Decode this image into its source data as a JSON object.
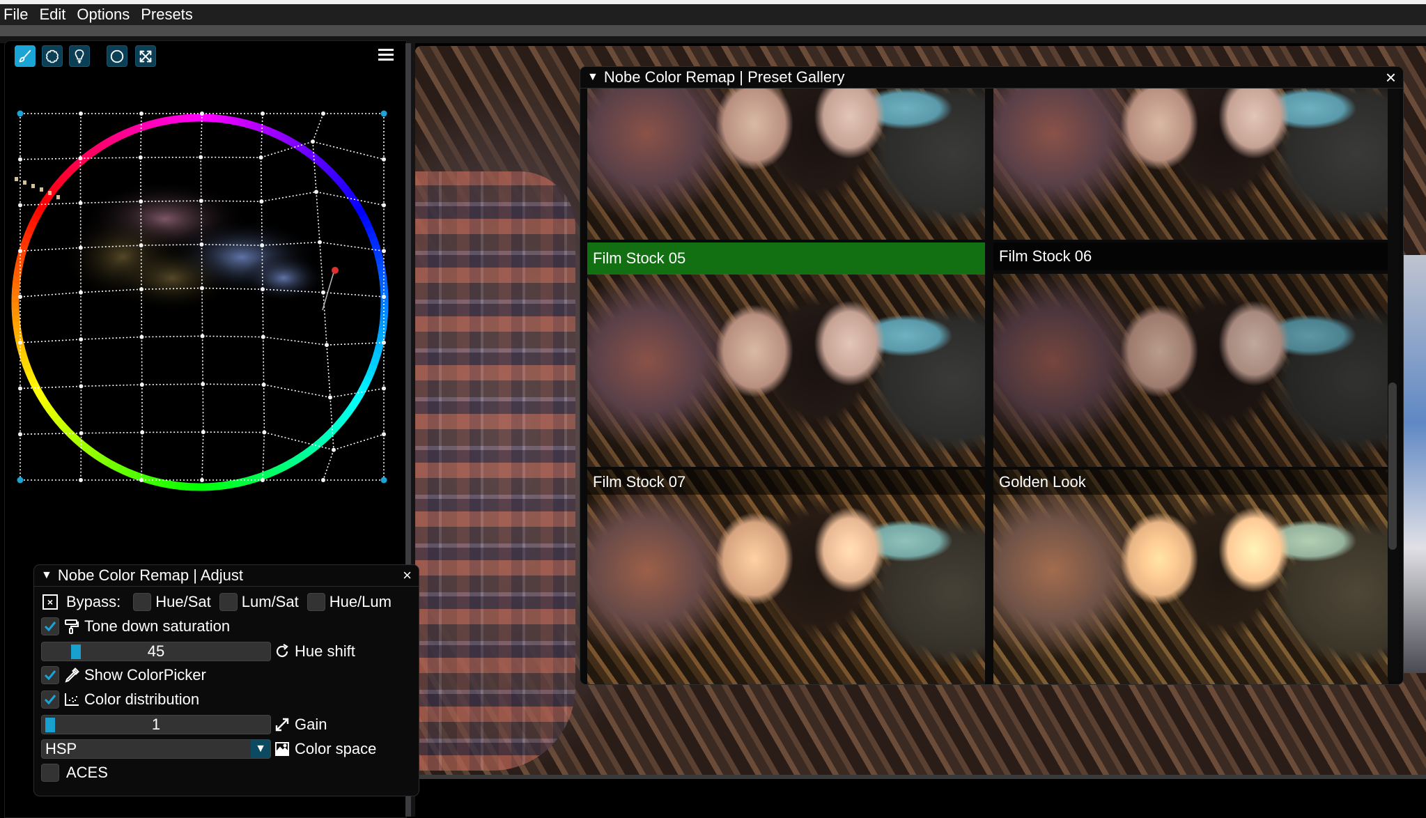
{
  "menubar": {
    "items": [
      "File",
      "Edit",
      "Options",
      "Presets"
    ]
  },
  "left_toolbar": {
    "buttons": [
      {
        "icon": "brush-icon",
        "active": true
      },
      {
        "icon": "flower-icon",
        "active": false
      },
      {
        "icon": "lightbulb-icon",
        "active": false
      },
      {
        "icon": "circle-icon",
        "active": false
      },
      {
        "icon": "expand-icon",
        "active": false
      }
    ],
    "menu_icon": "hamburger-menu-icon"
  },
  "color_wheel": {
    "grid_columns": 7,
    "grid_rows": 9,
    "accent_handle_color": "#1aa5d6",
    "selected_point_color": "#e03030"
  },
  "gallery": {
    "title": "Nobe Color Remap | Preset Gallery",
    "close_symbol": "×",
    "presets": [
      {
        "label": "",
        "selected": false
      },
      {
        "label": "",
        "selected": false
      },
      {
        "label": "Film Stock 05",
        "selected": true
      },
      {
        "label": "Film Stock 06",
        "selected": false
      },
      {
        "label": "Film Stock 07",
        "selected": false
      },
      {
        "label": "Golden Look",
        "selected": false
      }
    ],
    "selected_color": "#1e8c1e"
  },
  "adjust": {
    "title": "Nobe Color Remap | Adjust",
    "close_symbol": "×",
    "bypass_label": "Bypass:",
    "bypass_options": [
      {
        "label": "Hue/Sat",
        "checked": false
      },
      {
        "label": "Lum/Sat",
        "checked": false
      },
      {
        "label": "Hue/Lum",
        "checked": false
      }
    ],
    "tone_down_saturation": {
      "label": "Tone down saturation",
      "checked": true
    },
    "hue_shift": {
      "label": "Hue shift",
      "value": "45"
    },
    "show_colorpicker": {
      "label": "Show ColorPicker",
      "checked": true
    },
    "color_distribution": {
      "label": "Color distribution",
      "checked": true
    },
    "gain": {
      "label": "Gain",
      "value": "1"
    },
    "color_space": {
      "label": "Color space",
      "value": "HSP"
    },
    "aces": {
      "label": "ACES",
      "checked": false
    }
  }
}
